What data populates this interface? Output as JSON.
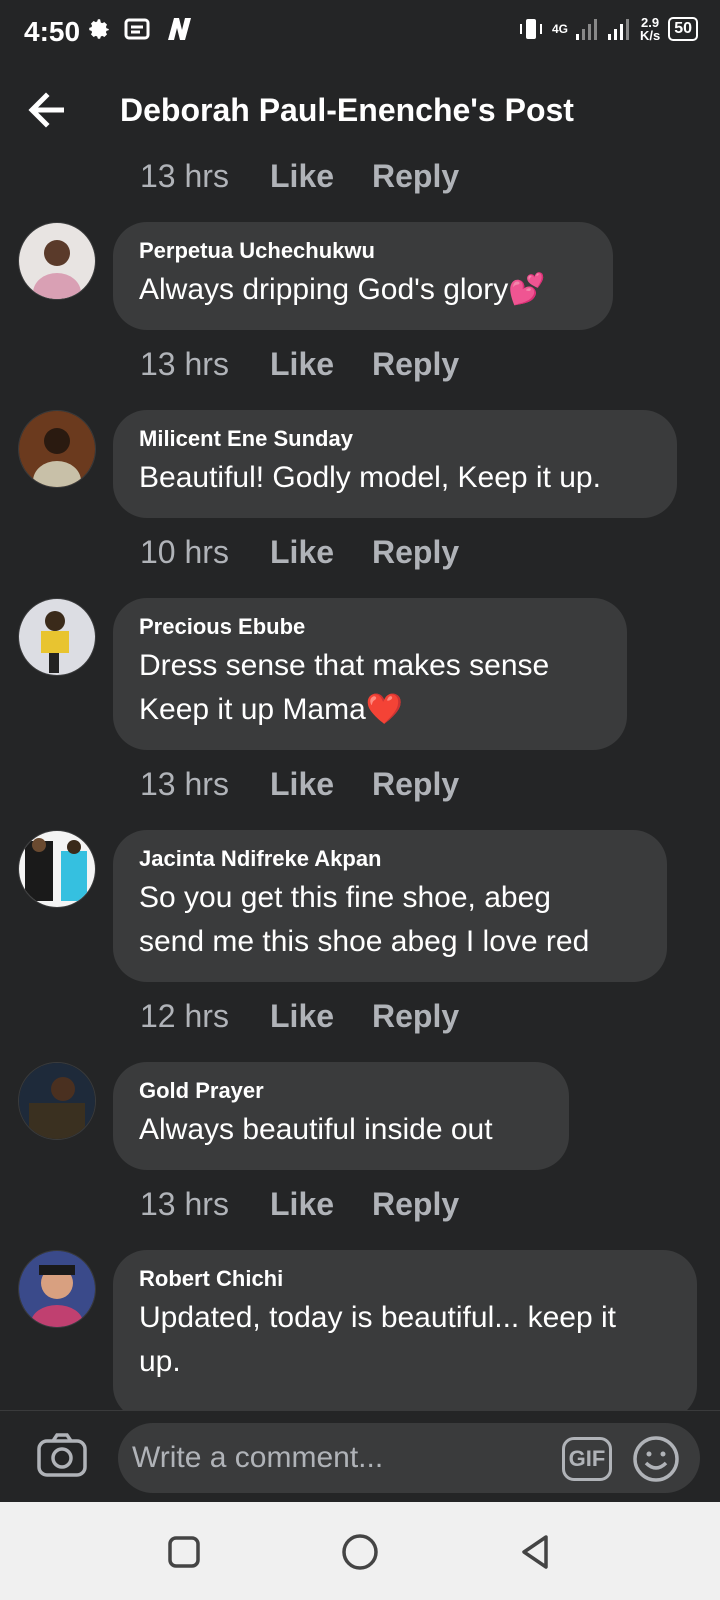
{
  "status": {
    "time": "4:50",
    "network_type": "4G",
    "net_speed_value": "2.9",
    "net_speed_unit": "K/s",
    "battery": "50"
  },
  "header": {
    "title": "Deborah Paul-Enenche's Post"
  },
  "top_meta": {
    "time": "13 hrs",
    "like": "Like",
    "reply": "Reply"
  },
  "comments": [
    {
      "author": "Perpetua Uchechukwu",
      "lines": [
        "Always dripping God's glory💕"
      ],
      "time": "13 hrs",
      "like": "Like",
      "reply": "Reply"
    },
    {
      "author": "Milicent Ene Sunday",
      "lines": [
        "Beautiful! Godly model, Keep it up."
      ],
      "time": "10 hrs",
      "like": "Like",
      "reply": "Reply"
    },
    {
      "author": "Precious Ebube",
      "lines": [
        "Dress sense that makes sense",
        "Keep it up Mama❤️"
      ],
      "time": "13 hrs",
      "like": "Like",
      "reply": "Reply"
    },
    {
      "author": "Jacinta Ndifreke Akpan",
      "lines": [
        "So you get this fine shoe, abeg",
        "send me this shoe abeg I love red"
      ],
      "time": "12 hrs",
      "like": "Like",
      "reply": "Reply"
    },
    {
      "author": "Gold Prayer",
      "lines": [
        "Always beautiful inside out"
      ],
      "time": "13 hrs",
      "like": "Like",
      "reply": "Reply"
    },
    {
      "author": "Robert Chichi",
      "lines": [
        "Updated, today is beautiful... keep it",
        "up."
      ]
    }
  ],
  "composer": {
    "placeholder": "Write a comment...",
    "gif_label": "GIF"
  },
  "colors": {
    "background": "#242526",
    "bubble": "#3a3b3c",
    "muted_text": "#b0b3b8",
    "nav_bar": "#f0f0f0"
  }
}
